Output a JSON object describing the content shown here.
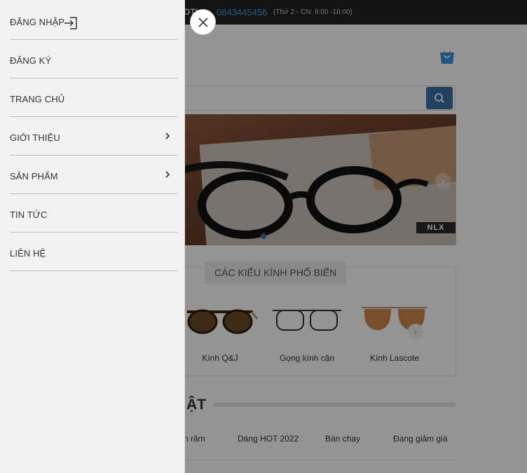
{
  "topbar": {
    "hotline_label": "OTL:",
    "phone": "0843445456",
    "hours": "(Thứ 2 - CN: 9:00 -18:00)"
  },
  "banner": {
    "brand_badge": "NLX"
  },
  "styles_section": {
    "title": "CÁC KIỂU KÍNH PHỔ BIẾN",
    "items": [
      {
        "label": "Kính Q&J"
      },
      {
        "label": "Gọng kính cận"
      },
      {
        "label": "Kính Lascote"
      }
    ]
  },
  "featured_section": {
    "title_fragment": "ẬT",
    "tabs": [
      "n râm",
      "Dáng HOT 2022",
      "Bán chạy",
      "Đang giảm giá"
    ]
  },
  "drawer": {
    "items": [
      {
        "label": "ĐĂNG NHẬP",
        "icon": "login-icon"
      },
      {
        "label": "ĐĂNG KÝ"
      },
      {
        "label": "TRANG CHỦ"
      },
      {
        "label": "GIỚI THIỆU",
        "icon": "chevron-right-icon"
      },
      {
        "label": "SẢN PHẨM",
        "icon": "chevron-right-icon"
      },
      {
        "label": "TIN TỨC"
      },
      {
        "label": "LIÊN HỆ"
      }
    ],
    "close_icon": "close-icon"
  },
  "colors": {
    "drawer_bg": "#f2f2f2",
    "accent_blue": "#3b6ea5",
    "topbar_bg": "#222222",
    "phone_blue": "#4aa3e0"
  }
}
